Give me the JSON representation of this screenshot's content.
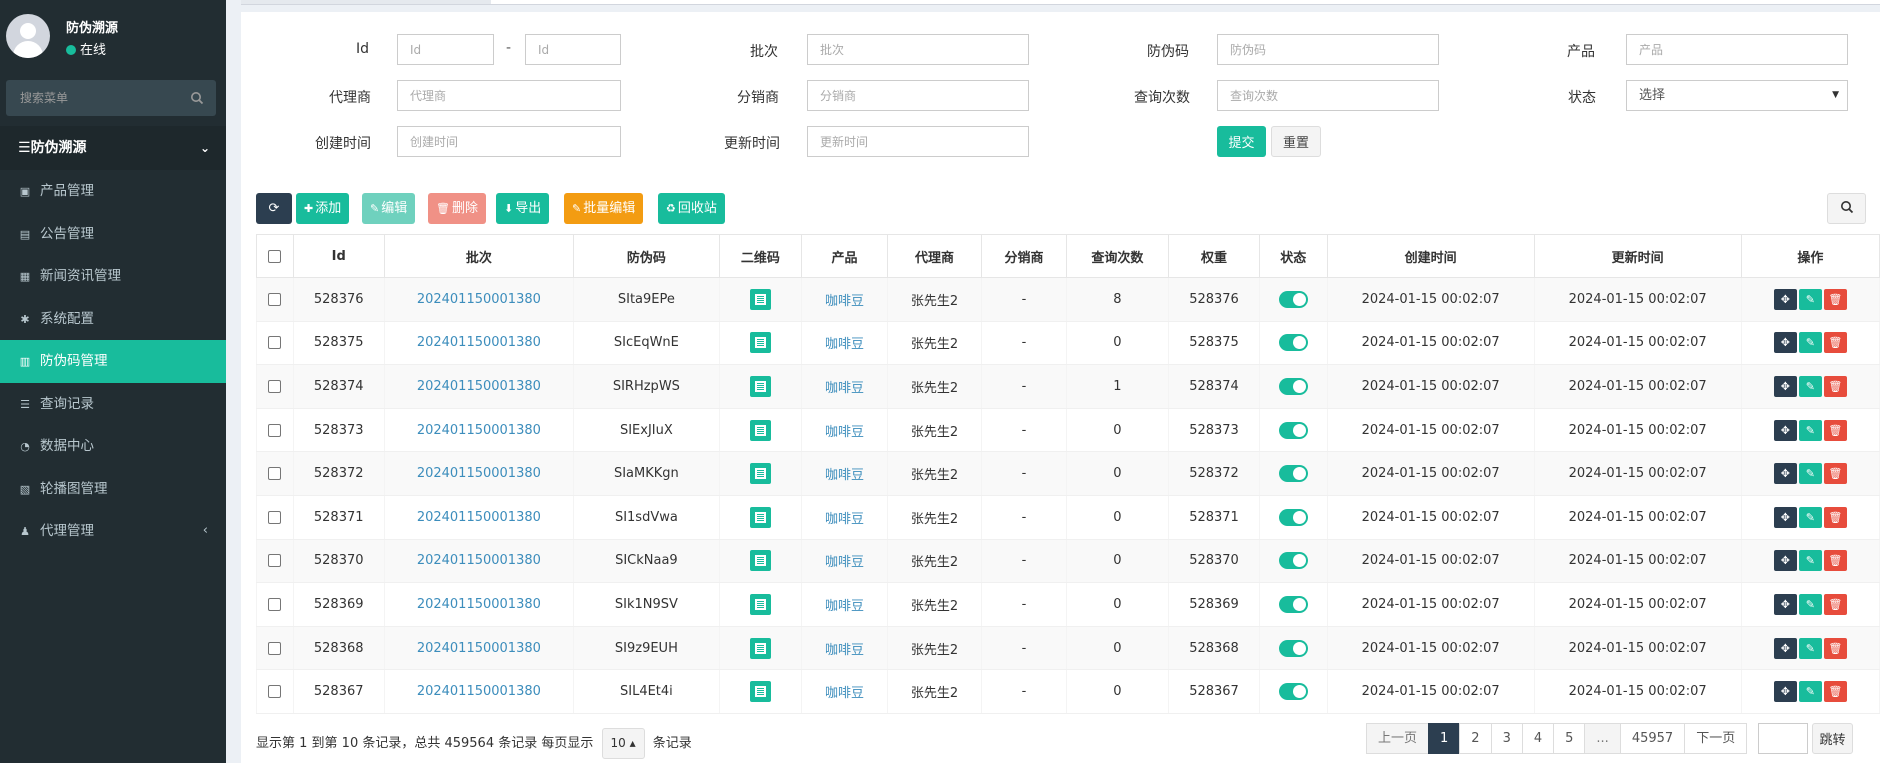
{
  "user": {
    "name": "防伪溯源",
    "status": "在线"
  },
  "sidebar": {
    "search_placeholder": "搜索菜单",
    "section_title": "防伪溯源",
    "items": [
      {
        "label": "产品管理",
        "icon": "cube-icon"
      },
      {
        "label": "公告管理",
        "icon": "file-icon"
      },
      {
        "label": "新闻资讯管理",
        "icon": "newspaper-icon"
      },
      {
        "label": "系统配置",
        "icon": "gear-icon"
      },
      {
        "label": "防伪码管理",
        "icon": "barcode-icon",
        "active": true
      },
      {
        "label": "查询记录",
        "icon": "list-icon"
      },
      {
        "label": "数据中心",
        "icon": "dashboard-icon"
      },
      {
        "label": "轮播图管理",
        "icon": "image-icon"
      },
      {
        "label": "代理管理",
        "icon": "users-icon"
      }
    ]
  },
  "filters": {
    "id_label": "Id",
    "id_from_placeholder": "Id",
    "id_to_placeholder": "Id",
    "id_separator": "-",
    "batch_label": "批次",
    "batch_placeholder": "批次",
    "code_label": "防伪码",
    "code_placeholder": "防伪码",
    "product_label": "产品",
    "product_placeholder": "产品",
    "agent_label": "代理商",
    "agent_placeholder": "代理商",
    "dist_label": "分销商",
    "dist_placeholder": "分销商",
    "query_label": "查询次数",
    "query_placeholder": "查询次数",
    "status_label": "状态",
    "status_value": "选择",
    "created_label": "创建时间",
    "created_placeholder": "创建时间",
    "updated_label": "更新时间",
    "updated_placeholder": "更新时间",
    "submit": "提交",
    "reset": "重置"
  },
  "toolbar": {
    "add": "添加",
    "edit": "编辑",
    "delete": "删除",
    "export": "导出",
    "batch_edit": "批量编辑",
    "recycle": "回收站"
  },
  "table": {
    "columns": [
      "Id",
      "批次",
      "防伪码",
      "二维码",
      "产品",
      "代理商",
      "分销商",
      "查询次数",
      "权重",
      "状态",
      "创建时间",
      "更新时间",
      "操作"
    ],
    "rows": [
      {
        "id": "528376",
        "batch": "202401150001380",
        "code": "SIta9EPe",
        "product": "咖啡豆",
        "agent": "张先生2",
        "dist": "-",
        "queries": "8",
        "weight": "528376",
        "created": "2024-01-15 00:02:07",
        "updated": "2024-01-15 00:02:07"
      },
      {
        "id": "528375",
        "batch": "202401150001380",
        "code": "SIcEqWnE",
        "product": "咖啡豆",
        "agent": "张先生2",
        "dist": "-",
        "queries": "0",
        "weight": "528375",
        "created": "2024-01-15 00:02:07",
        "updated": "2024-01-15 00:02:07"
      },
      {
        "id": "528374",
        "batch": "202401150001380",
        "code": "SIRHzpWS",
        "product": "咖啡豆",
        "agent": "张先生2",
        "dist": "-",
        "queries": "1",
        "weight": "528374",
        "created": "2024-01-15 00:02:07",
        "updated": "2024-01-15 00:02:07"
      },
      {
        "id": "528373",
        "batch": "202401150001380",
        "code": "SIExJIuX",
        "product": "咖啡豆",
        "agent": "张先生2",
        "dist": "-",
        "queries": "0",
        "weight": "528373",
        "created": "2024-01-15 00:02:07",
        "updated": "2024-01-15 00:02:07"
      },
      {
        "id": "528372",
        "batch": "202401150001380",
        "code": "SIaMKKgn",
        "product": "咖啡豆",
        "agent": "张先生2",
        "dist": "-",
        "queries": "0",
        "weight": "528372",
        "created": "2024-01-15 00:02:07",
        "updated": "2024-01-15 00:02:07"
      },
      {
        "id": "528371",
        "batch": "202401150001380",
        "code": "SI1sdVwa",
        "product": "咖啡豆",
        "agent": "张先生2",
        "dist": "-",
        "queries": "0",
        "weight": "528371",
        "created": "2024-01-15 00:02:07",
        "updated": "2024-01-15 00:02:07"
      },
      {
        "id": "528370",
        "batch": "202401150001380",
        "code": "SICkNaa9",
        "product": "咖啡豆",
        "agent": "张先生2",
        "dist": "-",
        "queries": "0",
        "weight": "528370",
        "created": "2024-01-15 00:02:07",
        "updated": "2024-01-15 00:02:07"
      },
      {
        "id": "528369",
        "batch": "202401150001380",
        "code": "SIk1N9SV",
        "product": "咖啡豆",
        "agent": "张先生2",
        "dist": "-",
        "queries": "0",
        "weight": "528369",
        "created": "2024-01-15 00:02:07",
        "updated": "2024-01-15 00:02:07"
      },
      {
        "id": "528368",
        "batch": "202401150001380",
        "code": "SI9z9EUH",
        "product": "咖啡豆",
        "agent": "张先生2",
        "dist": "-",
        "queries": "0",
        "weight": "528368",
        "created": "2024-01-15 00:02:07",
        "updated": "2024-01-15 00:02:07"
      },
      {
        "id": "528367",
        "batch": "202401150001380",
        "code": "SIL4Et4i",
        "product": "咖啡豆",
        "agent": "张先生2",
        "dist": "-",
        "queries": "0",
        "weight": "528367",
        "created": "2024-01-15 00:02:07",
        "updated": "2024-01-15 00:02:07"
      }
    ]
  },
  "footer": {
    "info_prefix": "显示第 1 到第 10 条记录，总共 459564 条记录 每页显示",
    "page_size": "10",
    "info_suffix": "条记录",
    "prev": "上一页",
    "next": "下一页",
    "pages": [
      "1",
      "2",
      "3",
      "4",
      "5",
      "...",
      "45957"
    ],
    "current_page": "1",
    "jump": "跳转"
  },
  "colors": {
    "accent": "#18bc9c",
    "sidebar_bg": "#222d32",
    "dark_button": "#2c3e50",
    "warning": "#f39c12",
    "danger": "#e74c3c",
    "link": "#3c8dbc"
  }
}
